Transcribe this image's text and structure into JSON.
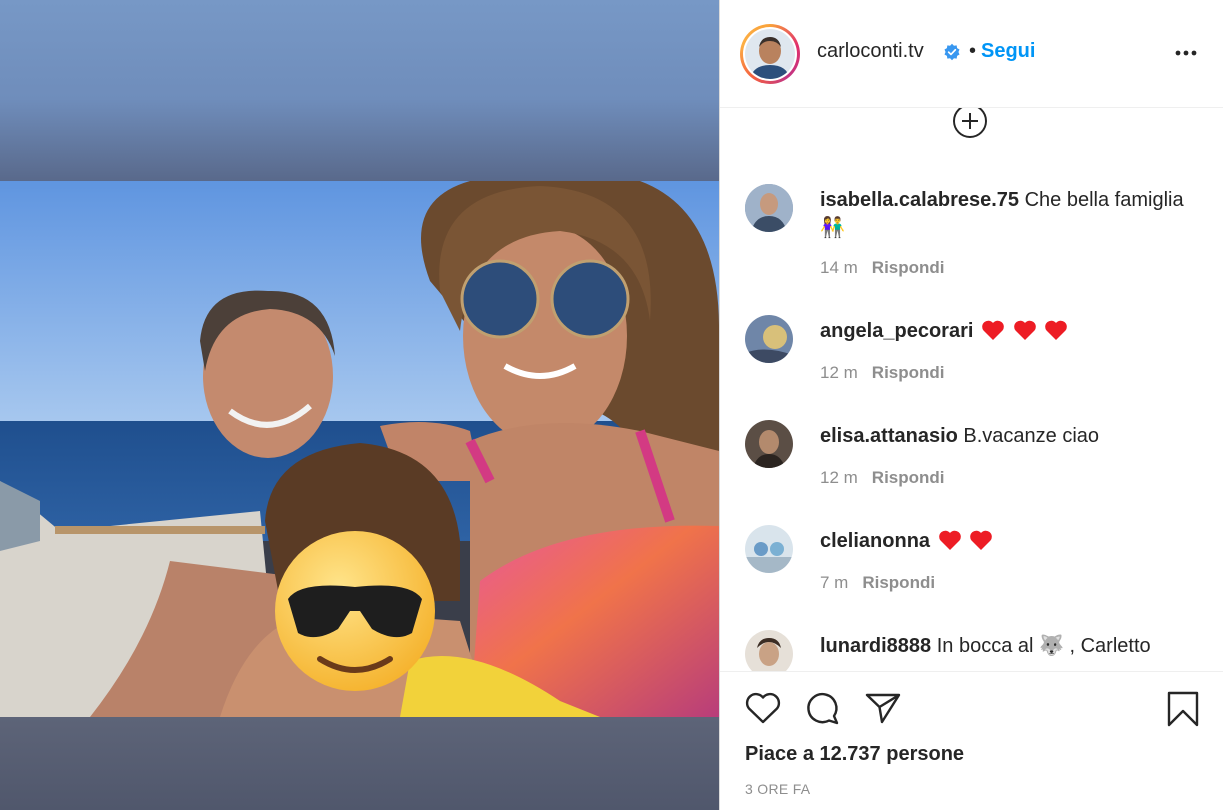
{
  "post": {
    "username": "carloconti.tv",
    "separator": "•",
    "follow_label": "Segui",
    "likes_text": "Piace a 12.737 persone",
    "time_text": "3 ORE FA"
  },
  "comments": [
    {
      "user": "isabella.calabrese.75",
      "text": "Che bella famiglia 👫",
      "time": "14 m",
      "reply": "Rispondi"
    },
    {
      "user": "angela_pecorari",
      "text": "",
      "hearts": 3,
      "time": "12 m",
      "reply": "Rispondi"
    },
    {
      "user": "elisa.attanasio",
      "text": "B.vacanze ciao",
      "time": "12 m",
      "reply": "Rispondi"
    },
    {
      "user": "clelianonna",
      "text": "",
      "hearts": 2,
      "time": "7 m",
      "reply": "Rispondi"
    },
    {
      "user": "lunardi8888",
      "text": "In bocca al 🐺 , Carletto",
      "time": "",
      "reply": ""
    }
  ],
  "icons": {
    "verified": "verified-badge-icon",
    "more": "more-options-icon",
    "load_more": "plus-circle-icon",
    "like": "heart-icon",
    "comment": "comment-icon",
    "share": "send-icon",
    "save": "bookmark-icon"
  },
  "colors": {
    "accent": "#0095f6",
    "text": "#262626",
    "muted": "#8e8e8e",
    "heart": "#ed1c24"
  }
}
